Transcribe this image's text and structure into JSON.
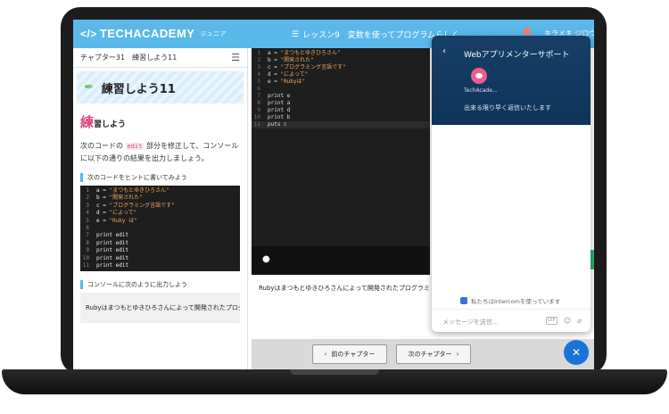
{
  "header": {
    "logo_text": "TECHACADEMY",
    "logo_sub": "ジュニア",
    "lesson_text": "レッスン9　変数を使ってプログラムらしく",
    "user_name": "キラメキ ジロウ"
  },
  "left": {
    "chapter_label": "チャプター31　練習しよう11",
    "title": "練習しよう11",
    "section_big": "練",
    "section_rest": "習しよう",
    "para_before": "次のコードの",
    "para_tag": "edit",
    "para_after": "部分を修正して、コンソールに以下の通りの結果を出力しましょう。",
    "hint1": "次のコードをヒントに書いてみよう",
    "code": [
      {
        "n": "1",
        "pre": "a = ",
        "str": "\"まつもとゆきひろさん\""
      },
      {
        "n": "2",
        "pre": "b = ",
        "str": "\"開発された\""
      },
      {
        "n": "3",
        "pre": "c = ",
        "str": "\"プログラミング言語です\""
      },
      {
        "n": "4",
        "pre": "d = ",
        "str": "\"によって\""
      },
      {
        "n": "5",
        "pre": "e = ",
        "str": "\"Ruby は\""
      },
      {
        "n": "6",
        "pre": "",
        "str": ""
      },
      {
        "n": "7",
        "pre": "print edit",
        "str": ""
      },
      {
        "n": "8",
        "pre": "print edit",
        "str": ""
      },
      {
        "n": "9",
        "pre": "print edit",
        "str": ""
      },
      {
        "n": "10",
        "pre": "print edit",
        "str": ""
      },
      {
        "n": "11",
        "pre": "print edit",
        "str": ""
      }
    ],
    "hint2": "コンソールに次のように出力しよう",
    "output": "Rubyはまつもとゆきひろさんによって開発されたプログラミ"
  },
  "editor": {
    "lines": [
      {
        "n": "1",
        "pre": "a = ",
        "str": "\"まつもとゆきひろさん\""
      },
      {
        "n": "2",
        "pre": "b = ",
        "str": "\"開発された\""
      },
      {
        "n": "3",
        "pre": "c = ",
        "str": "\"プログラミング言語です\""
      },
      {
        "n": "4",
        "pre": "d = ",
        "str": "\"によって\""
      },
      {
        "n": "5",
        "pre": "e = ",
        "str": "\"Rubyは\""
      },
      {
        "n": "6",
        "pre": "",
        "str": ""
      },
      {
        "n": "7",
        "pre": "print e",
        "str": ""
      },
      {
        "n": "8",
        "pre": "print a",
        "str": ""
      },
      {
        "n": "9",
        "pre": "print d",
        "str": ""
      },
      {
        "n": "10",
        "pre": "print b",
        "str": ""
      },
      {
        "n": "11",
        "pre": "puts c",
        "str": ""
      }
    ],
    "result_text": "Rubyはまつもとゆきひろさんによって開発されたプログラミ"
  },
  "nav": {
    "prev_label": "前のチャプター",
    "next_label": "次のチャプター"
  },
  "chat": {
    "title": "Webアプリメンターサポート",
    "mascot_name": "TechAcade...",
    "subtitle": "出来る限り早く返信いたします",
    "powered": "私たちはIntercomを使っています",
    "placeholder": "メッセージを送信...",
    "gif_label": "GIF"
  },
  "icons": {
    "logo": "code-brackets-icon",
    "lesson": "list-icon",
    "bell": "bell-icon",
    "menu": "hamburger-icon",
    "pen": "pen-nib-icon",
    "console": "speech-bubble-icon",
    "back": "chevron-left-icon",
    "emoji": "smile-icon",
    "attach": "paperclip-icon",
    "close": "close-icon"
  },
  "colors": {
    "header": "#5ab9ea",
    "accent_pink": "#e0457b",
    "chat_header": "#173f67",
    "fab": "#1a73d6"
  }
}
